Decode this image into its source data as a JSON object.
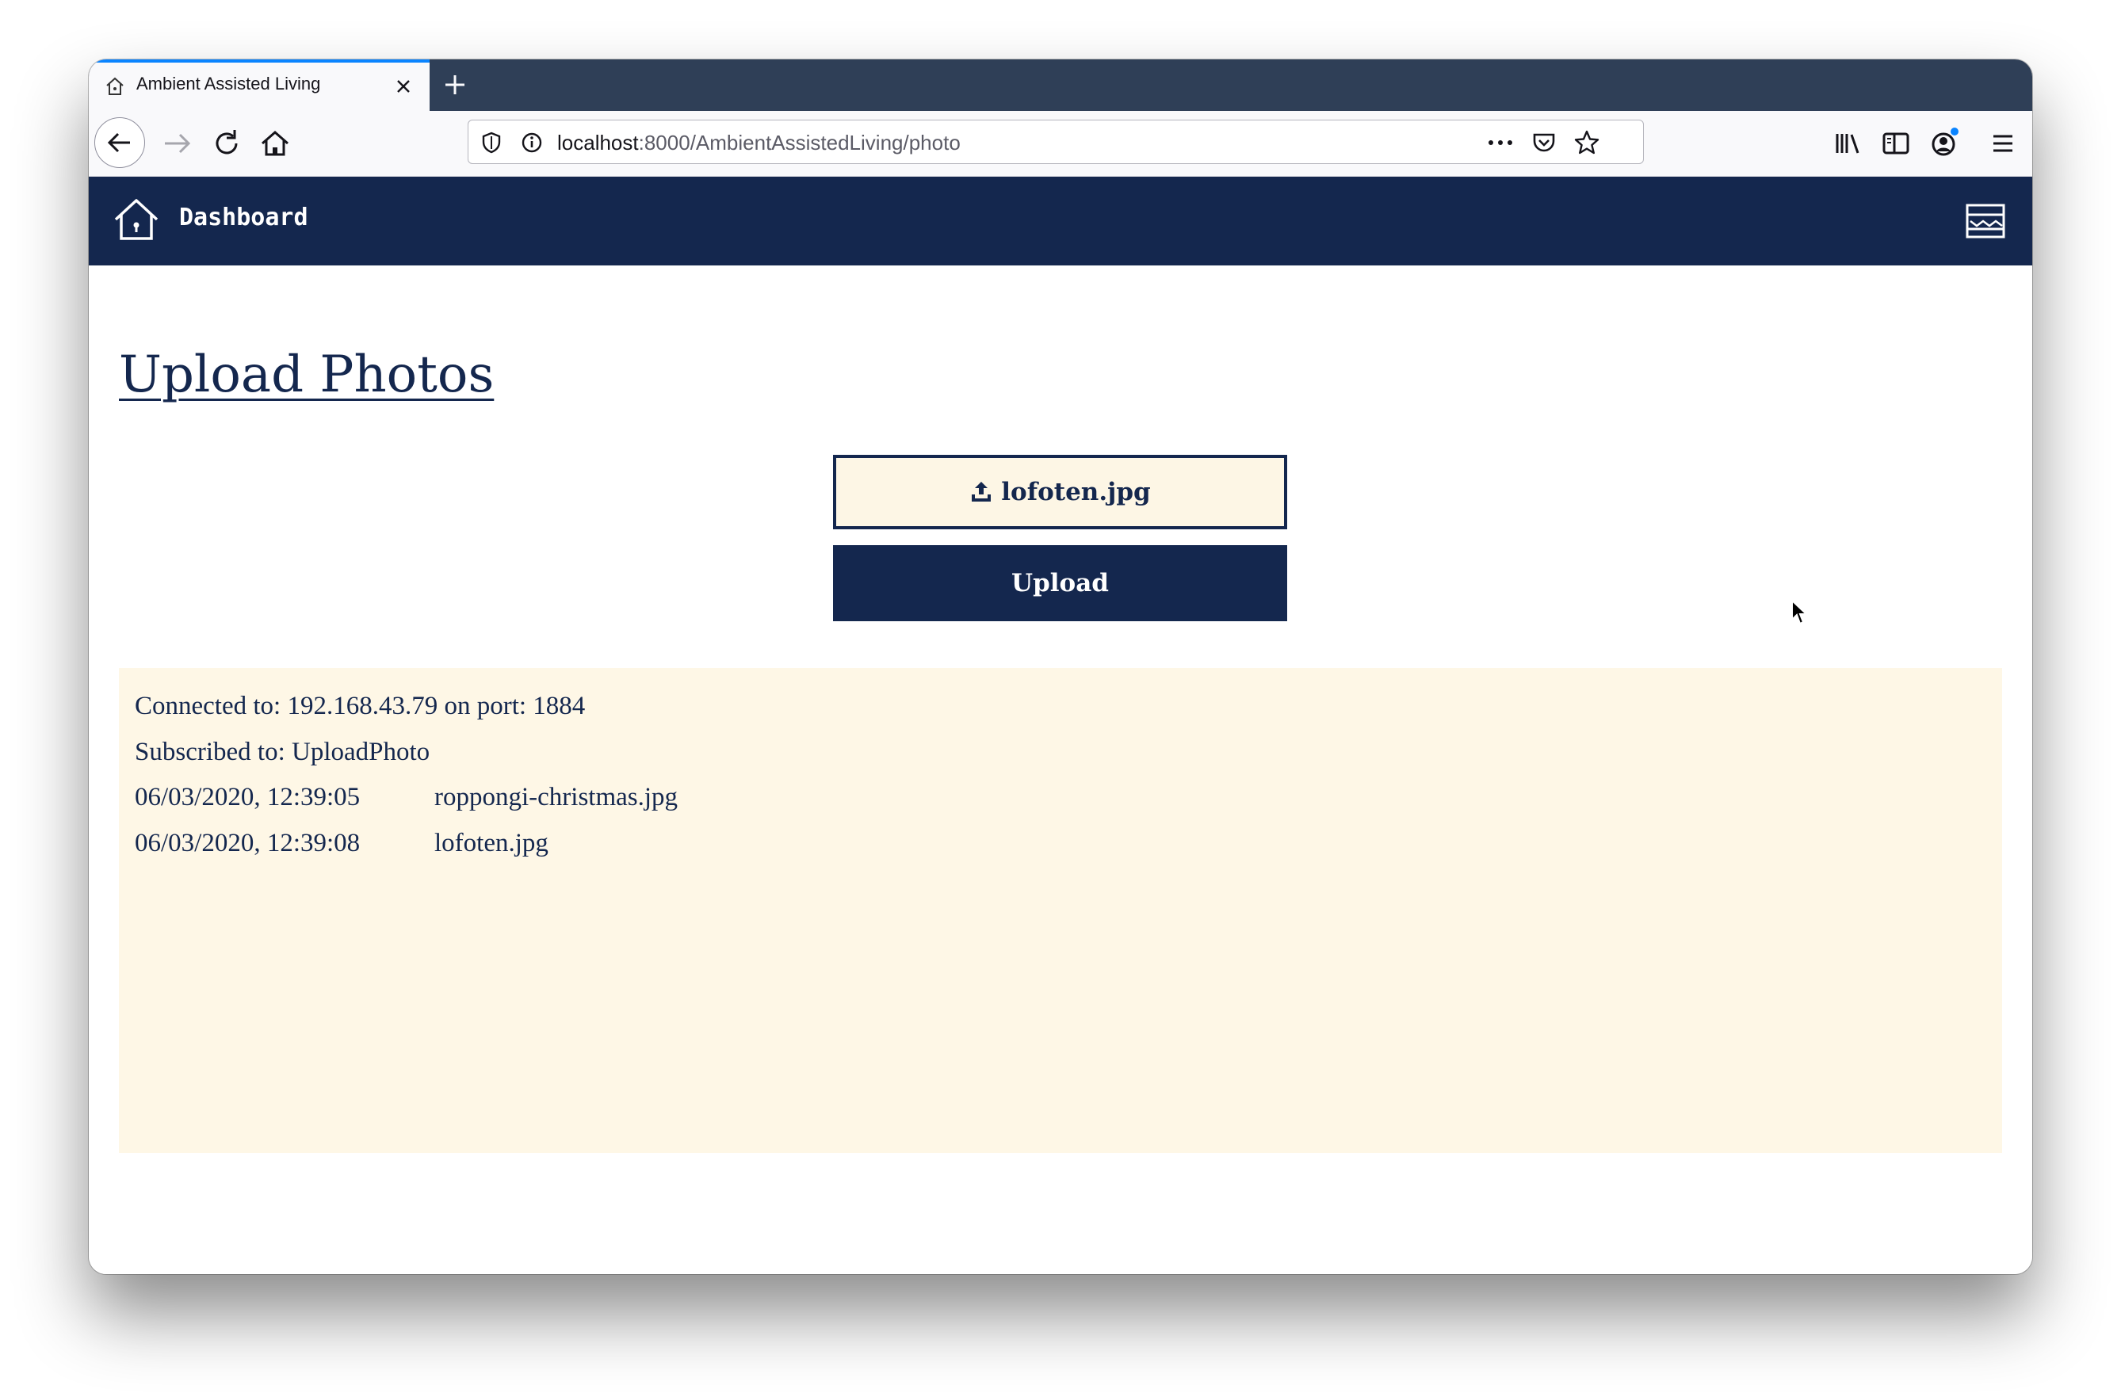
{
  "browser": {
    "tab_title": "Ambient Assisted Living",
    "url_host": "localhost",
    "url_path": ":8000/AmbientAssistedLiving/photo"
  },
  "app": {
    "brand": "Dashboard"
  },
  "main": {
    "title": "Upload Photos",
    "file_label": "lofoten.jpg",
    "upload_label": "Upload"
  },
  "log": {
    "connected": "Connected to: 192.168.43.79 on port: 1884",
    "subscribed": "Subscribed to: UploadPhoto",
    "entries": [
      {
        "time": "06/03/2020, 12:39:05",
        "file": "roppongi-christmas.jpg"
      },
      {
        "time": "06/03/2020, 12:39:08",
        "file": "lofoten.jpg"
      }
    ]
  },
  "colors": {
    "primary": "#14274e",
    "panel_bg": "#fef7e6",
    "tabstrip": "#2f3f57"
  }
}
